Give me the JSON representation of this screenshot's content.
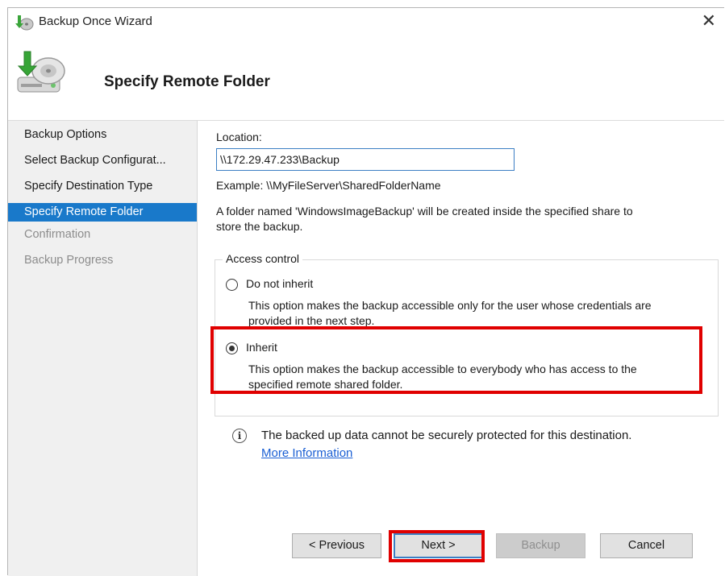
{
  "window": {
    "title": "Backup Once Wizard",
    "close_glyph": "✕",
    "icon": "backup-wizard-icon"
  },
  "header": {
    "title": "Specify Remote Folder",
    "icon": "backup-drive-icon"
  },
  "nav": {
    "items": [
      {
        "label": "Backup Options",
        "state": "normal"
      },
      {
        "label": "Select Backup Configurat...",
        "state": "normal"
      },
      {
        "label": "Specify Destination Type",
        "state": "normal"
      },
      {
        "label": "Specify Remote Folder",
        "state": "active"
      },
      {
        "label": "Confirmation",
        "state": "disabled"
      },
      {
        "label": "Backup Progress",
        "state": "disabled"
      }
    ]
  },
  "form": {
    "location_label": "Location:",
    "location_value": "\\\\172.29.47.233\\Backup",
    "example_text": "Example: \\\\MyFileServer\\SharedFolderName",
    "folder_note_line1": "A folder named 'WindowsImageBackup' will be created inside the specified share to",
    "folder_note_line2": "store the backup.",
    "access_control": {
      "legend": "Access control",
      "options": [
        {
          "label": "Do not inherit",
          "checked": false,
          "desc_line1": "This option makes the backup accessible only for the user whose credentials are",
          "desc_line2": "provided in the next step."
        },
        {
          "label": "Inherit",
          "checked": true,
          "desc_line1": "This option makes the backup accessible to everybody who has access to the",
          "desc_line2": "specified remote shared folder."
        }
      ]
    },
    "info_text": "The backed up data cannot be securely protected for this destination.",
    "info_link": "More Information"
  },
  "buttons": {
    "previous": "< Previous",
    "next": "Next >",
    "backup": "Backup",
    "cancel": "Cancel"
  },
  "colors": {
    "highlight": "#e00000",
    "nav_active": "#1979ca",
    "link": "#1a5fd4"
  }
}
